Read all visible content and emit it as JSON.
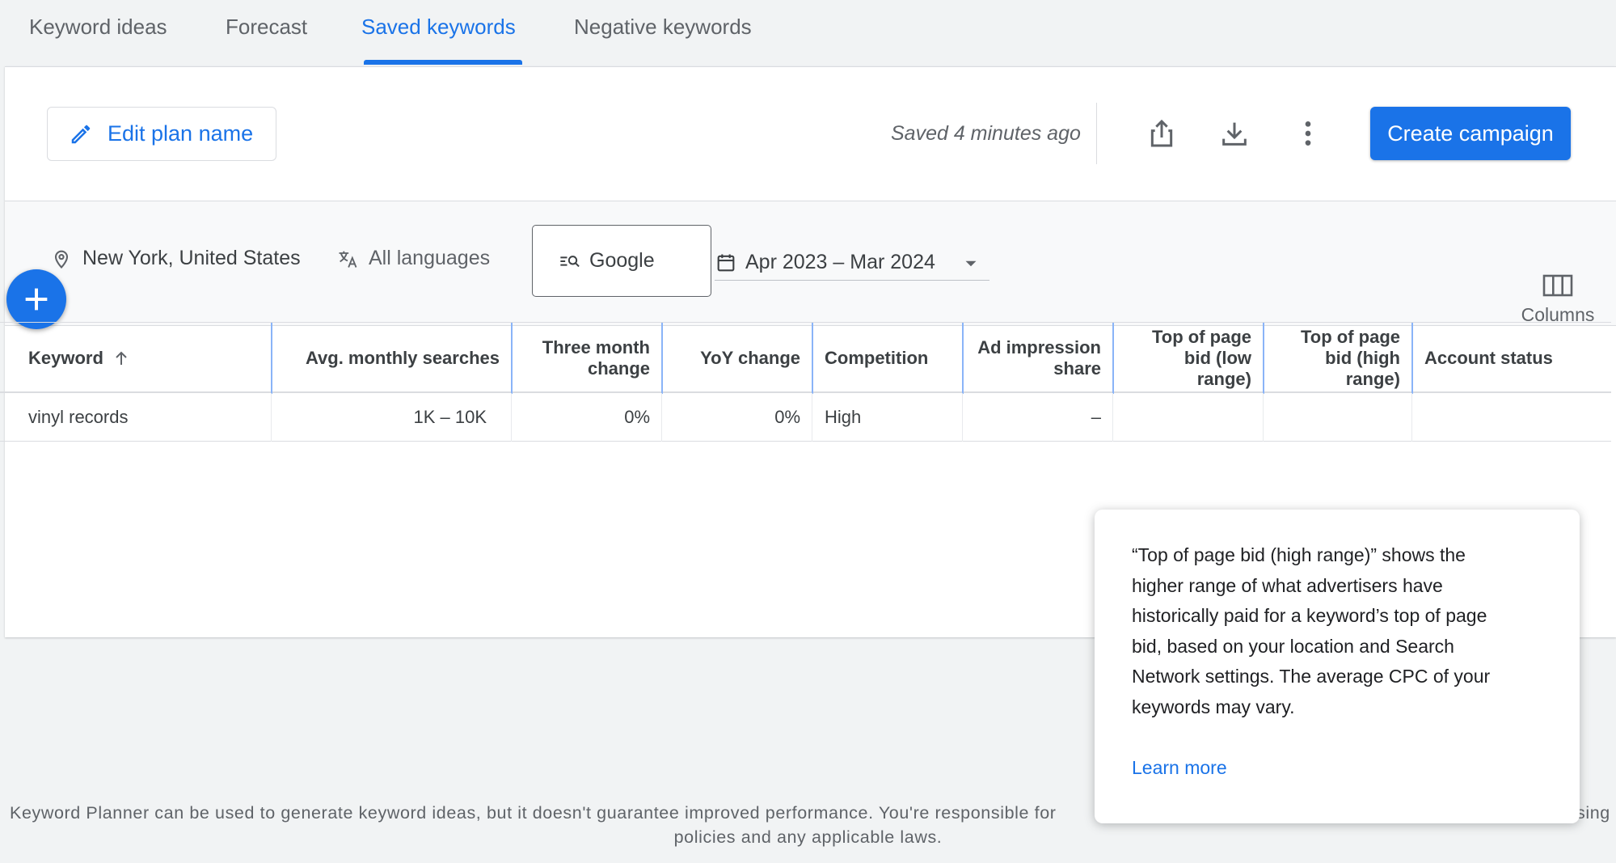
{
  "tabs": [
    {
      "label": "Keyword ideas"
    },
    {
      "label": "Forecast"
    },
    {
      "label": "Saved keywords"
    },
    {
      "label": "Negative keywords"
    }
  ],
  "active_tab": "Saved keywords",
  "toolbar": {
    "edit_label": "Edit plan name",
    "saved_status": "Saved 4 minutes ago",
    "create_label": "Create campaign",
    "icons": [
      "pencil-icon",
      "share-icon",
      "download-icon",
      "more-vert-icon"
    ]
  },
  "filters": {
    "location": "New York, United States",
    "language": "All languages",
    "network": "Google",
    "date_range": "Apr 2023 – Mar 2024"
  },
  "columns_label": "Columns",
  "table": {
    "headers": [
      {
        "line1": "Keyword",
        "line2": "",
        "line3": ""
      },
      {
        "line1": "Avg. monthly searches",
        "line2": "",
        "line3": ""
      },
      {
        "line1": "Three month",
        "line2": "change",
        "line3": ""
      },
      {
        "line1": "YoY change",
        "line2": "",
        "line3": ""
      },
      {
        "line1": "Competition",
        "line2": "",
        "line3": ""
      },
      {
        "line1": "Ad impression",
        "line2": "share",
        "line3": ""
      },
      {
        "line1": "Top of page",
        "line2": "bid (low range)",
        "line3": ""
      },
      {
        "line1": "Top of page",
        "line2": "bid (high",
        "line3": "range)"
      },
      {
        "line1": "Account status",
        "line2": "",
        "line3": ""
      }
    ],
    "rows": [
      {
        "keyword": "vinyl records",
        "avg_monthly_searches": "1K – 10K",
        "three_month_change": "0%",
        "yoy_change": "0%",
        "competition": "High",
        "ad_impression_share": "–"
      }
    ]
  },
  "tooltip": {
    "line1": "“Top of page bid (high range)” shows the",
    "line2": "higher range of what advertisers have",
    "line3": "historically paid for a keyword’s top of page",
    "line4": "bid, based on your location and Search",
    "line5": "Network settings. The average CPC of your",
    "line6": "keywords may vary.",
    "link": "Learn more"
  },
  "footer": {
    "line1_left": "Keyword Planner can be used to generate keyword ideas, but it doesn't guarantee improved performance. You're responsible for",
    "line1_right": "sing",
    "line2": "policies and any applicable laws."
  },
  "colors": {
    "accent": "#1a73e8",
    "background": "#f1f3f4",
    "text": "#3c4043"
  }
}
